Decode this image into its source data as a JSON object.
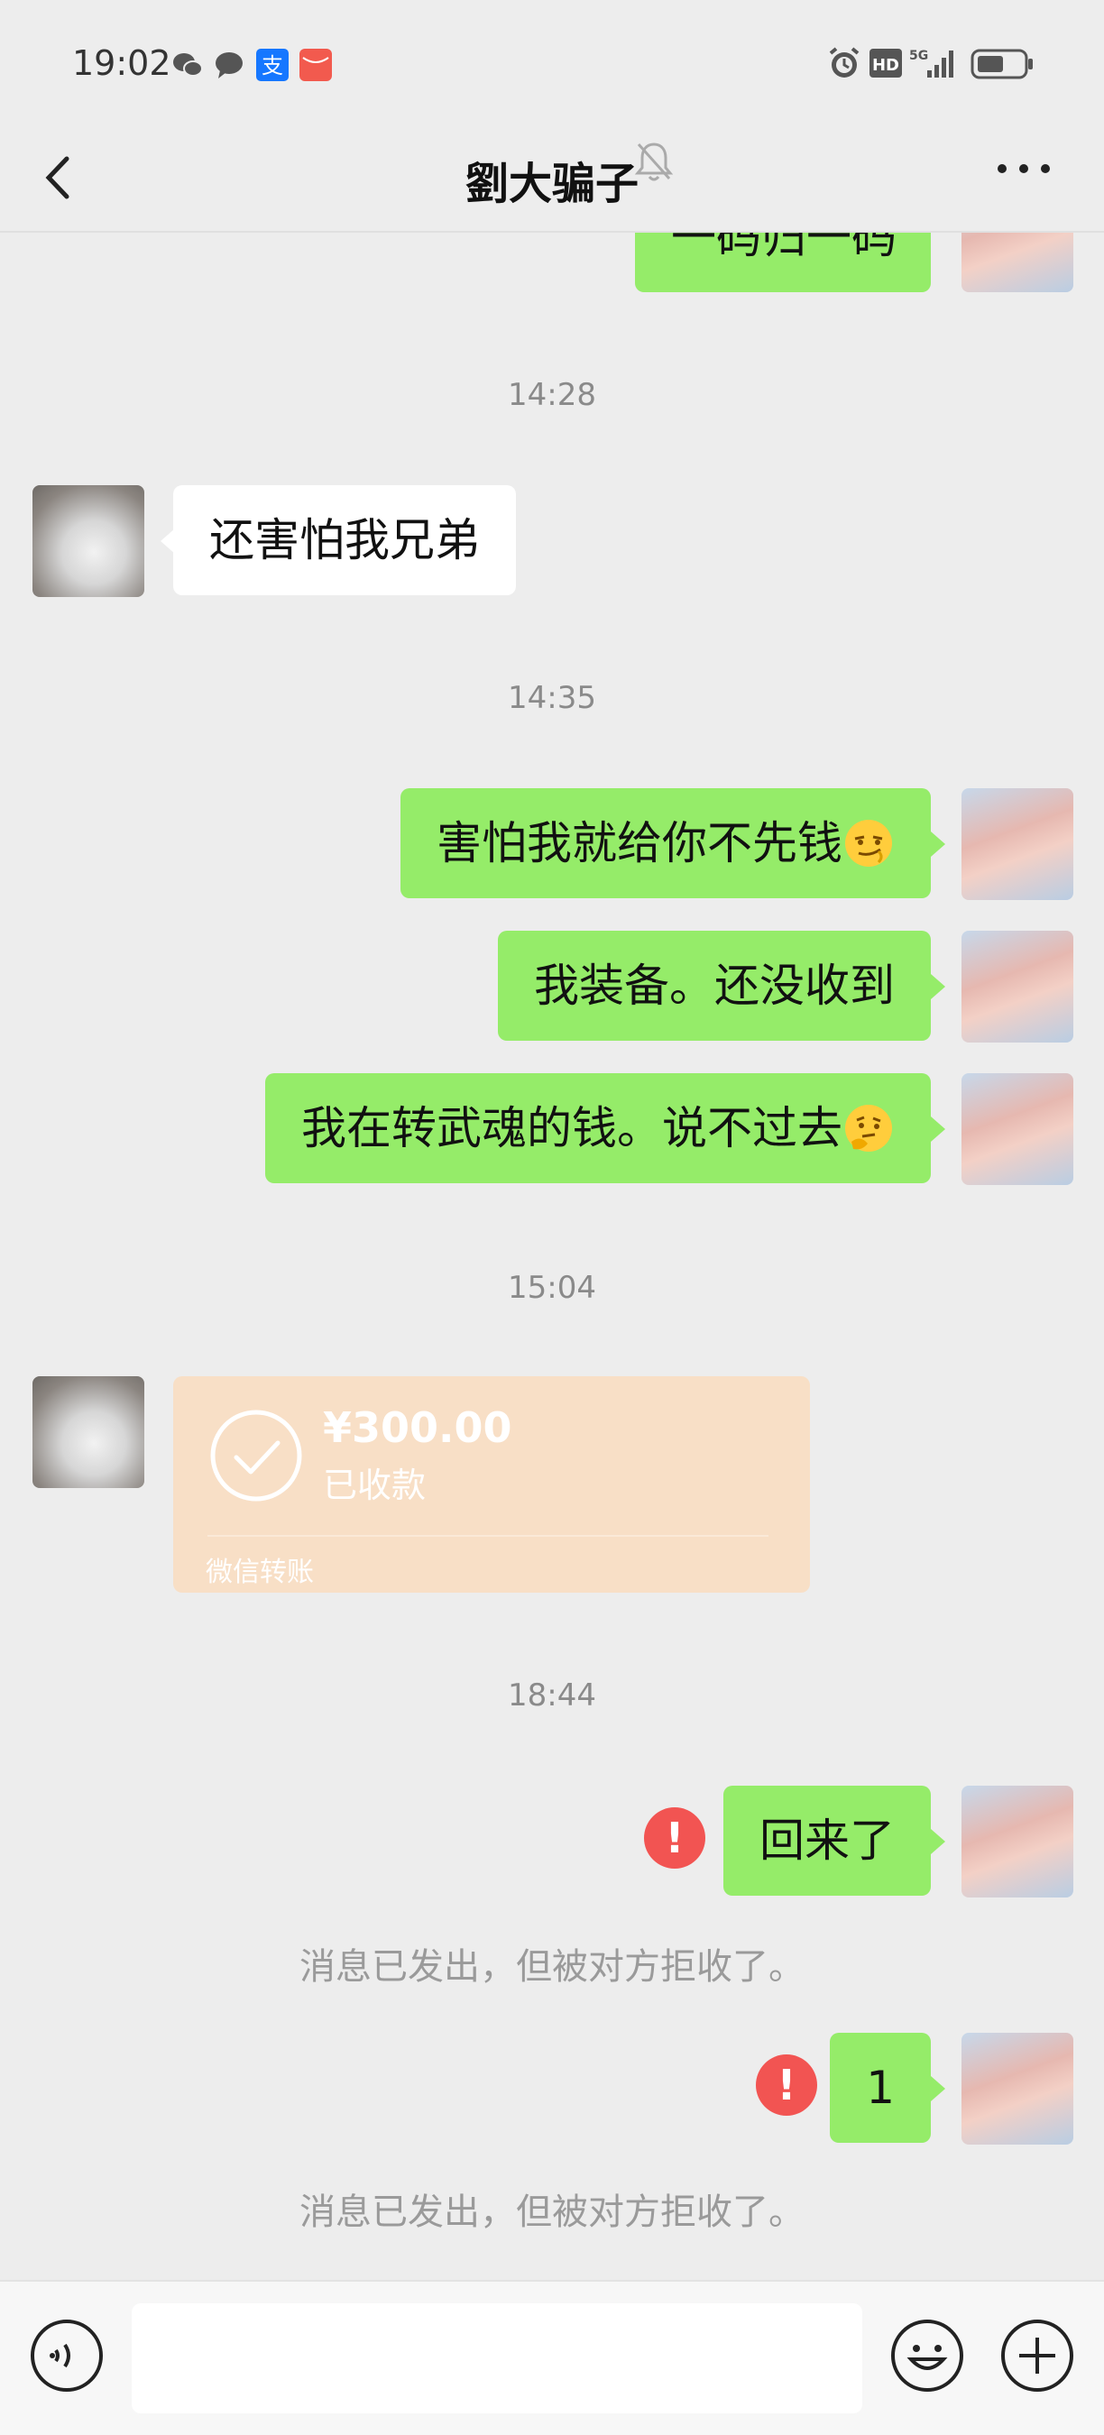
{
  "status_bar": {
    "time": "19:02",
    "left_icons": [
      "wechat-icon",
      "message-icon",
      "alipay-icon",
      "red-app-icon"
    ],
    "right_icons": [
      "alarm-icon",
      "hd-icon",
      "5g-signal-icon",
      "battery-icon"
    ],
    "hd_label": "HD",
    "network_label": "5G"
  },
  "nav": {
    "title": "劉大骗子",
    "back_icon": "chevron-left-icon",
    "mute_icon": "bell-muted-icon",
    "more_icon": "more-dots-icon"
  },
  "messages": {
    "partial_top": "一码归一码",
    "time_1": "14:28",
    "other_1": "还害怕我兄弟",
    "time_2": "14:35",
    "me_1": "害怕我就给你不先钱",
    "me_1_emoji": "smirk-emoji",
    "me_2": "我装备。还没收到",
    "me_3": "我在转武魂的钱。说不过去",
    "me_3_emoji": "thinking-emoji",
    "time_3": "15:04",
    "time_4": "18:44",
    "me_4": "回来了",
    "rejected_note_1": "消息已发出，但被对方拒收了。",
    "me_5": "1",
    "rejected_note_2": "消息已发出，但被对方拒收了。"
  },
  "transfer": {
    "amount": "¥300.00",
    "status": "已收款",
    "type": "微信转账"
  },
  "input_bar": {
    "voice_icon": "voice-icon",
    "emoji_icon": "emoji-icon",
    "plus_icon": "plus-icon",
    "text_value": ""
  },
  "colors": {
    "background": "#ededed",
    "my_bubble": "#95ec69",
    "other_bubble": "#ffffff",
    "transfer_card": "#f8dfc6",
    "error_red": "#f25452"
  }
}
